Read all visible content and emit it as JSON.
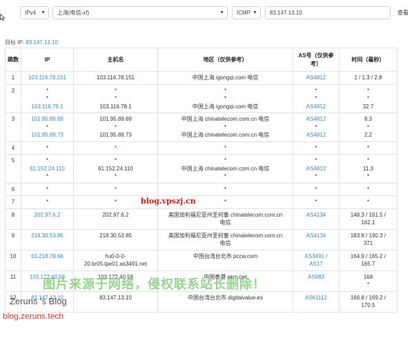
{
  "toolbar": {
    "ip_version": "IPv4",
    "location": "上海(电信-xf)",
    "protocol": "ICMP",
    "target_value": "83.147.13.10",
    "query_label": "查看"
  },
  "target": {
    "label": "目标 IP:",
    "value": "83.147.13.10"
  },
  "table": {
    "headers": [
      "跳数",
      "IP",
      "主机名",
      "地区（仅供参考）",
      "AS号（仅供参考）",
      "时间（毫秒）"
    ],
    "rows": [
      {
        "hop": "1",
        "ip": [
          "103.116.78.151"
        ],
        "host": [
          "103.116.78.151"
        ],
        "region": [
          "中国上海 igongqi.com 电信"
        ],
        "asn": [
          "AS4812"
        ],
        "time": [
          "1 / 1.3 / 2.8"
        ]
      },
      {
        "hop": "2",
        "ip": [
          "*",
          "*",
          "103.116.78.1"
        ],
        "host": [
          "*",
          "*",
          "103.116.78.1"
        ],
        "region": [
          "*",
          "*",
          "中国上海 igongqi.com 电信"
        ],
        "asn": [
          "*",
          "*",
          "AS4812"
        ],
        "time": [
          "*",
          "*",
          "32.7"
        ]
      },
      {
        "hop": "3",
        "ip": [
          "101.95.89.69",
          "*",
          "101.95.89.73"
        ],
        "host": [
          "101.95.89.69",
          "*",
          "101.95.89.73"
        ],
        "region": [
          "中国上海 chinatelecom.com.cn 电信",
          "*",
          "中国上海 chinatelecom.com.cn 电信"
        ],
        "asn": [
          "AS4812",
          "*",
          "AS4812"
        ],
        "time": [
          "8.3",
          "*",
          "2.2"
        ]
      },
      {
        "hop": "4",
        "ip": [
          "*"
        ],
        "host": [
          "*"
        ],
        "region": [
          "*"
        ],
        "asn": [
          "*"
        ],
        "time": [
          "*"
        ]
      },
      {
        "hop": "5",
        "ip": [
          "*",
          "61.152.24.110",
          "*"
        ],
        "host": [
          "*",
          "61.152.24.110",
          "*"
        ],
        "region": [
          "*",
          "中国上海 chinatelecom.com.cn 电信",
          "*"
        ],
        "asn": [
          "*",
          "AS4812",
          "*"
        ],
        "time": [
          "*",
          "11.3",
          "*"
        ]
      },
      {
        "hop": "6",
        "ip": [
          "*"
        ],
        "host": [
          "*"
        ],
        "region": [
          "*"
        ],
        "asn": [
          "*"
        ],
        "time": [
          "*"
        ]
      },
      {
        "hop": "7",
        "ip": [
          "*"
        ],
        "host": [
          "*"
        ],
        "region": [
          "*"
        ],
        "asn": [
          "*"
        ],
        "time": [
          "*"
        ]
      },
      {
        "hop": "8",
        "ip": [
          "202.97.6.2"
        ],
        "host": [
          "202.97.6.2"
        ],
        "region": [
          "美国加利福尼亚州圣何塞 chinatelecom.com.cn",
          "电信"
        ],
        "asn": [
          "AS4134"
        ],
        "time": [
          "148.3 / 161.5 /",
          "162.1"
        ]
      },
      {
        "hop": "9",
        "ip": [
          "218.30.53.85"
        ],
        "host": [
          "218.30.53.85"
        ],
        "region": [
          "美国加利福尼亚州圣何塞 chinatelecom.com.cn",
          "电信"
        ],
        "asn": [
          "AS4134"
        ],
        "time": [
          "183.8 / 190.3 /",
          "371"
        ]
      },
      {
        "hop": "10",
        "ip": [
          "63.218.78.66"
        ],
        "host": [
          "hu0-0-0-",
          "20.br05.tpe01.as3491.net"
        ],
        "region": [
          "中国台湾台北市 pccw.com"
        ],
        "asn": [
          "AS3491 /",
          "AS17"
        ],
        "time": [
          "164.9 / 165.2 /",
          "165.7"
        ]
      },
      {
        "hop": "11",
        "ip": [
          "103.172.40.58"
        ],
        "host": [
          "103.172.40.58"
        ],
        "region": [
          "中国香港 akm.net"
        ],
        "asn": [
          "AS983"
        ],
        "time": [
          "168",
          "*"
        ]
      },
      {
        "hop": "12",
        "ip": [
          "83.147.13.10"
        ],
        "host": [
          "83.147.13.10"
        ],
        "region": [
          "中国台湾台北市 digitalvalue.es"
        ],
        "asn": [
          "AS61112"
        ],
        "time": [
          "166.8 / 169.2 /",
          "170.5"
        ]
      }
    ]
  },
  "watermarks": {
    "blog": "blog.vpszj.cn",
    "notice": "图片来源于网络，侵权联系站长删除！",
    "zerun_title": "Zeruns 's Blog",
    "zerun_url": "blog.zeruns.tech"
  }
}
